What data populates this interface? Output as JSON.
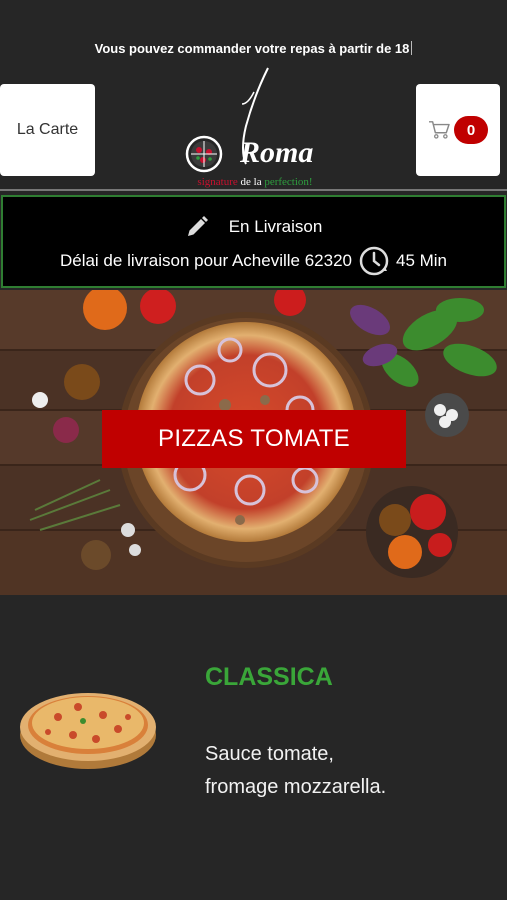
{
  "header": {
    "notice": "Vous pouvez commander votre repas à partir de 18",
    "menu_button_label": "La Carte",
    "cart_count": "0",
    "logo_text": "Roma",
    "logo_tagline_1": "signature",
    "logo_tagline_2": "de la",
    "logo_tagline_3": "perfection!"
  },
  "delivery": {
    "mode_label": "En Livraison",
    "delay_label": "Délai de livraison pour Acheville 62320",
    "delay_value": "45 Min",
    "icons": [
      "pencil-icon",
      "clock-icon"
    ],
    "border_color": "#2f7d32"
  },
  "hero": {
    "category_label": "PIZZAS TOMATE",
    "button_color": "#c00000"
  },
  "product": {
    "name": "CLASSICA",
    "description": "Sauce tomate, fromage mozzarella.",
    "name_color": "#3aa639"
  },
  "colors": {
    "background": "#262626",
    "accent_red": "#c00000"
  }
}
